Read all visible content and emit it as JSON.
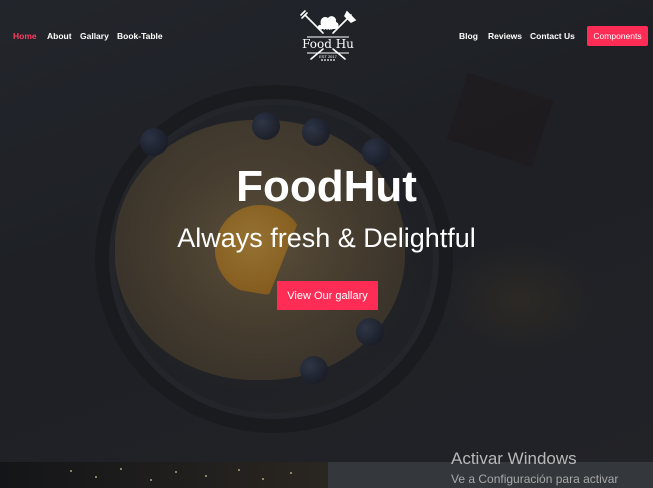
{
  "nav": {
    "left_items": [
      {
        "label": "Home",
        "active": true
      },
      {
        "label": "About"
      },
      {
        "label": "Gallary"
      },
      {
        "label": "Book-Table"
      }
    ],
    "right_items": [
      {
        "label": "Blog"
      },
      {
        "label": "Reviews"
      },
      {
        "label": "Contact Us"
      }
    ],
    "components_label": "Components",
    "active_color": "#ff3b62"
  },
  "logo": {
    "top_text": "THE",
    "name": "Food Hu",
    "est": "EST 2017",
    "icon": "fork-knife-chef-hat-icon"
  },
  "hero": {
    "title": "FoodHut",
    "subtitle": "Always fresh & Delightful",
    "cta_label": "View Our gallary",
    "accent_color": "#ff2d55"
  },
  "watermark": {
    "line1": "Activar Windows",
    "line2": "Ve a Configuración para activar"
  }
}
